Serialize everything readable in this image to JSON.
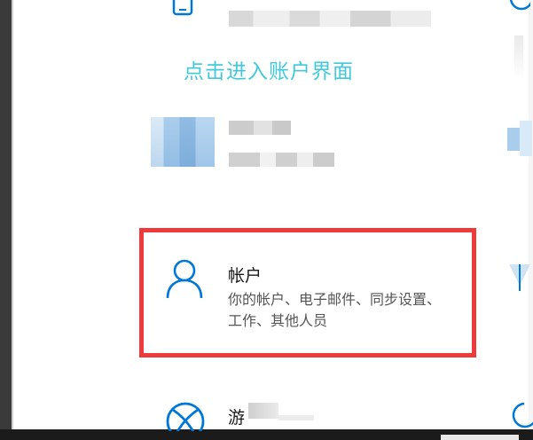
{
  "hint_text": "点击进入账户界面",
  "accounts_tile": {
    "title": "帐户",
    "description": "你的帐户、电子邮件、同步设置、工作、其他人员",
    "icon": "person-icon"
  },
  "gaming_tile": {
    "title_partial": "游",
    "icon": "xbox-icon"
  },
  "phone_tile": {
    "icon": "phone-icon"
  },
  "colors": {
    "hint": "#41c9da",
    "highlight": "#ef3a3a",
    "icon": "#0078d7"
  }
}
